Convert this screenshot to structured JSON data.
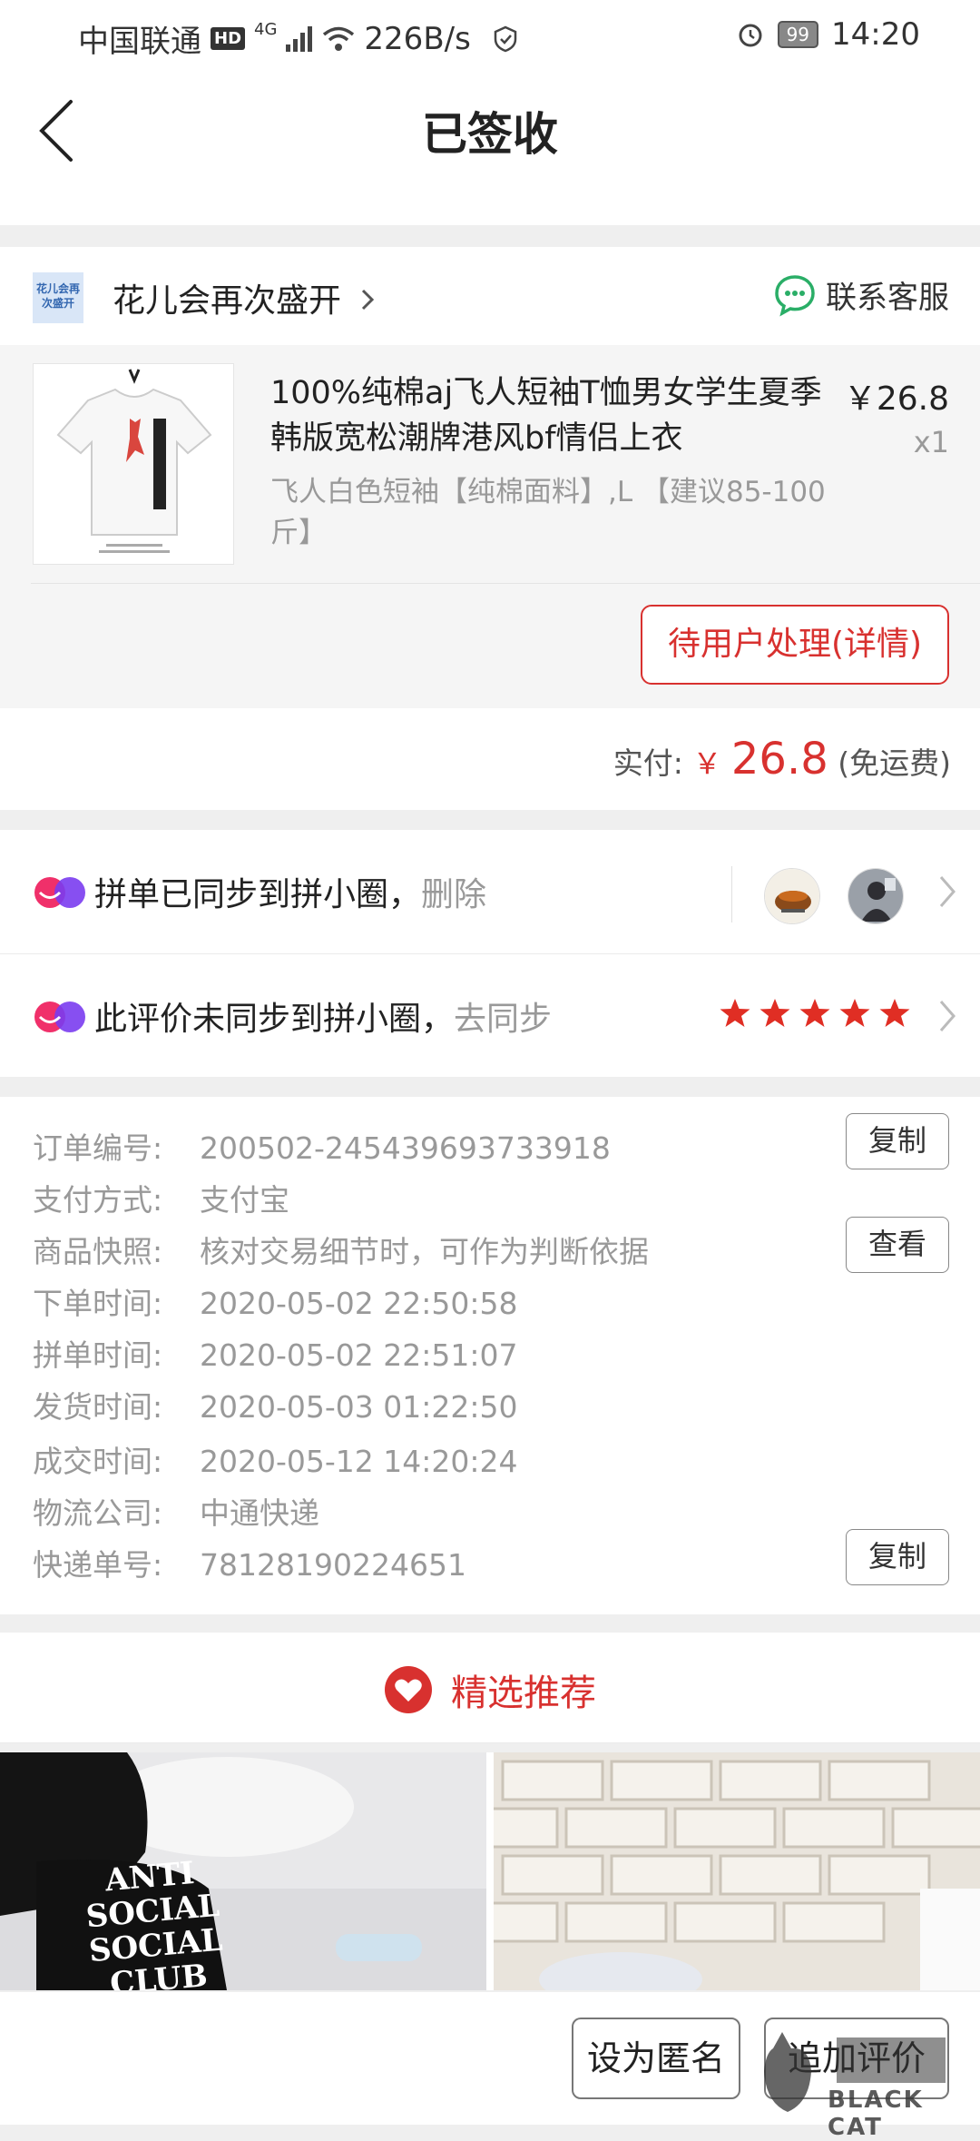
{
  "status_bar": {
    "carrier": "中国联通",
    "hd": "HD",
    "network": "4G",
    "speed": "226B/s",
    "battery": "99",
    "time": "14:20"
  },
  "header": {
    "title": "已签收"
  },
  "store": {
    "name": "花儿会再次盛开",
    "logo_text": "花儿会再次盛开",
    "contact_label": "联系客服"
  },
  "product": {
    "title": "100%纯棉aj飞人短袖T恤男女学生夏季韩版宽松潮牌港风bf情侣上衣",
    "spec": "飞人白色短袖【纯棉面料】,L 【建议85-100斤】",
    "price": "￥26.8",
    "quantity": "x1",
    "action_label": "待用户处理(详情)"
  },
  "payment": {
    "label": "实付:",
    "currency": "￥",
    "amount": "26.8",
    "note": "(免运费)"
  },
  "pxq": {
    "row1_text": "拼单已同步到拼小圈，",
    "row1_action": "删除",
    "row2_text": "此评价未同步到拼小圈，",
    "row2_action": "去同步",
    "rating_stars": 5
  },
  "order_info": {
    "rows": [
      {
        "label": "订单编号:",
        "value": "200502-245439693733918",
        "button": "复制"
      },
      {
        "label": "支付方式:",
        "value": "支付宝"
      },
      {
        "label": "商品快照:",
        "value": "核对交易细节时，可作为判断依据",
        "button": "查看"
      },
      {
        "label": "下单时间:",
        "value": "2020-05-02 22:50:58"
      },
      {
        "label": "拼单时间:",
        "value": "2020-05-02 22:51:07"
      },
      {
        "label": "发货时间:",
        "value": "2020-05-03 01:22:50"
      },
      {
        "label": "成交时间:",
        "value": "2020-05-12 14:20:24"
      },
      {
        "label": "物流公司:",
        "value": "中通快递"
      },
      {
        "label": "快递单号:",
        "value": "78128190224651",
        "button": "复制"
      }
    ]
  },
  "recommend": {
    "title": "精选推荐",
    "tile1_text": "ANTI SOCIAL SOCIAL CLUB"
  },
  "bottom_bar": {
    "anonymous_label": "设为匿名",
    "append_review_label": "追加评价"
  },
  "watermark": {
    "text": "BLACK CAT"
  },
  "colors": {
    "accent": "#d8312f",
    "wechat_green": "#2aae67",
    "pxq_purple": "#7a3cf0"
  }
}
